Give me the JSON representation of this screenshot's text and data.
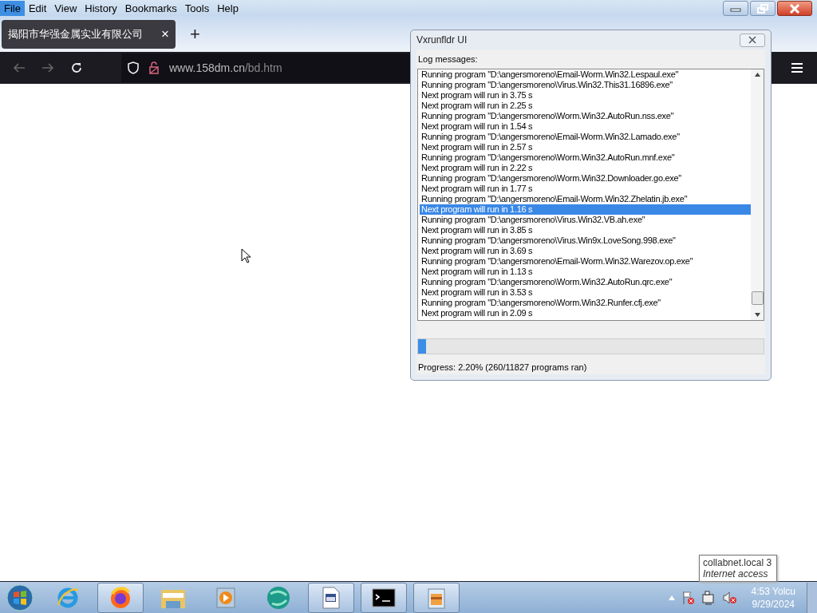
{
  "browser": {
    "menu": [
      {
        "label": "File",
        "selected": true
      },
      {
        "label": "Edit",
        "selected": false
      },
      {
        "label": "View",
        "selected": false
      },
      {
        "label": "History",
        "selected": false
      },
      {
        "label": "Bookmarks",
        "selected": false
      },
      {
        "label": "Tools",
        "selected": false
      },
      {
        "label": "Help",
        "selected": false
      }
    ],
    "tab": {
      "title": "揭阳市华强金属实业有限公司",
      "close": "×"
    },
    "new_tab": "+",
    "url": {
      "host": "www.158dm.cn",
      "path": "/bd.htm"
    }
  },
  "dialog": {
    "title": "Vxrunfldr UI",
    "log_label": "Log messages:",
    "log": [
      {
        "text": "Running program \"D:\\angersmoreno\\Email-Worm.Win32.Lespaul.exe\"",
        "selected": false
      },
      {
        "text": "Running program \"D:\\angersmoreno\\Virus.Win32.This31.16896.exe\"",
        "selected": false
      },
      {
        "text": "Next program will run in 3.75 s",
        "selected": false
      },
      {
        "text": "Next program will run in 2.25 s",
        "selected": false
      },
      {
        "text": "Running program \"D:\\angersmoreno\\Worm.Win32.AutoRun.nss.exe\"",
        "selected": false
      },
      {
        "text": "Next program will run in 1.54 s",
        "selected": false
      },
      {
        "text": "Running program \"D:\\angersmoreno\\Email-Worm.Win32.Lamado.exe\"",
        "selected": false
      },
      {
        "text": "Next program will run in 2.57 s",
        "selected": false
      },
      {
        "text": "Running program \"D:\\angersmoreno\\Worm.Win32.AutoRun.mnf.exe\"",
        "selected": false
      },
      {
        "text": "Next program will run in 2.22 s",
        "selected": false
      },
      {
        "text": "Running program \"D:\\angersmoreno\\Worm.Win32.Downloader.go.exe\"",
        "selected": false
      },
      {
        "text": "Next program will run in 1.77 s",
        "selected": false
      },
      {
        "text": "Running program \"D:\\angersmoreno\\Email-Worm.Win32.Zhelatin.jb.exe\"",
        "selected": false
      },
      {
        "text": "Next program will run in 1.16 s",
        "selected": true
      },
      {
        "text": "Running program \"D:\\angersmoreno\\Virus.Win32.VB.ah.exe\"",
        "selected": false
      },
      {
        "text": "Next program will run in 3.85 s",
        "selected": false
      },
      {
        "text": "Running program \"D:\\angersmoreno\\Virus.Win9x.LoveSong.998.exe\"",
        "selected": false
      },
      {
        "text": "Next program will run in 3.69 s",
        "selected": false
      },
      {
        "text": "Running program \"D:\\angersmoreno\\Email-Worm.Win32.Warezov.op.exe\"",
        "selected": false
      },
      {
        "text": "Next program will run in 1.13 s",
        "selected": false
      },
      {
        "text": "Running program \"D:\\angersmoreno\\Worm.Win32.AutoRun.qrc.exe\"",
        "selected": false
      },
      {
        "text": "Next program will run in 3.53 s",
        "selected": false
      },
      {
        "text": "Running program \"D:\\angersmoreno\\Worm.Win32.Runfer.cfj.exe\"",
        "selected": false
      },
      {
        "text": "Next program will run in 2.09 s",
        "selected": false
      }
    ],
    "progress": {
      "level": 0.022,
      "text": "Progress: 2.20% (260/11827 programs ran)"
    }
  },
  "tooltip": {
    "title": "collabnet.local  3",
    "subtitle": "Internet access"
  },
  "taskbar": {
    "items": [
      {
        "kind": "ie",
        "open": false
      },
      {
        "kind": "firefox",
        "open": true
      },
      {
        "kind": "folder",
        "open": false
      },
      {
        "kind": "media",
        "open": false
      },
      {
        "kind": "globe",
        "open": false
      },
      {
        "kind": "document",
        "open": true
      },
      {
        "kind": "console",
        "open": true
      },
      {
        "kind": "package",
        "open": true
      }
    ],
    "clock": {
      "time": "4:53 Yolcu",
      "date": "9/29/2024"
    }
  }
}
